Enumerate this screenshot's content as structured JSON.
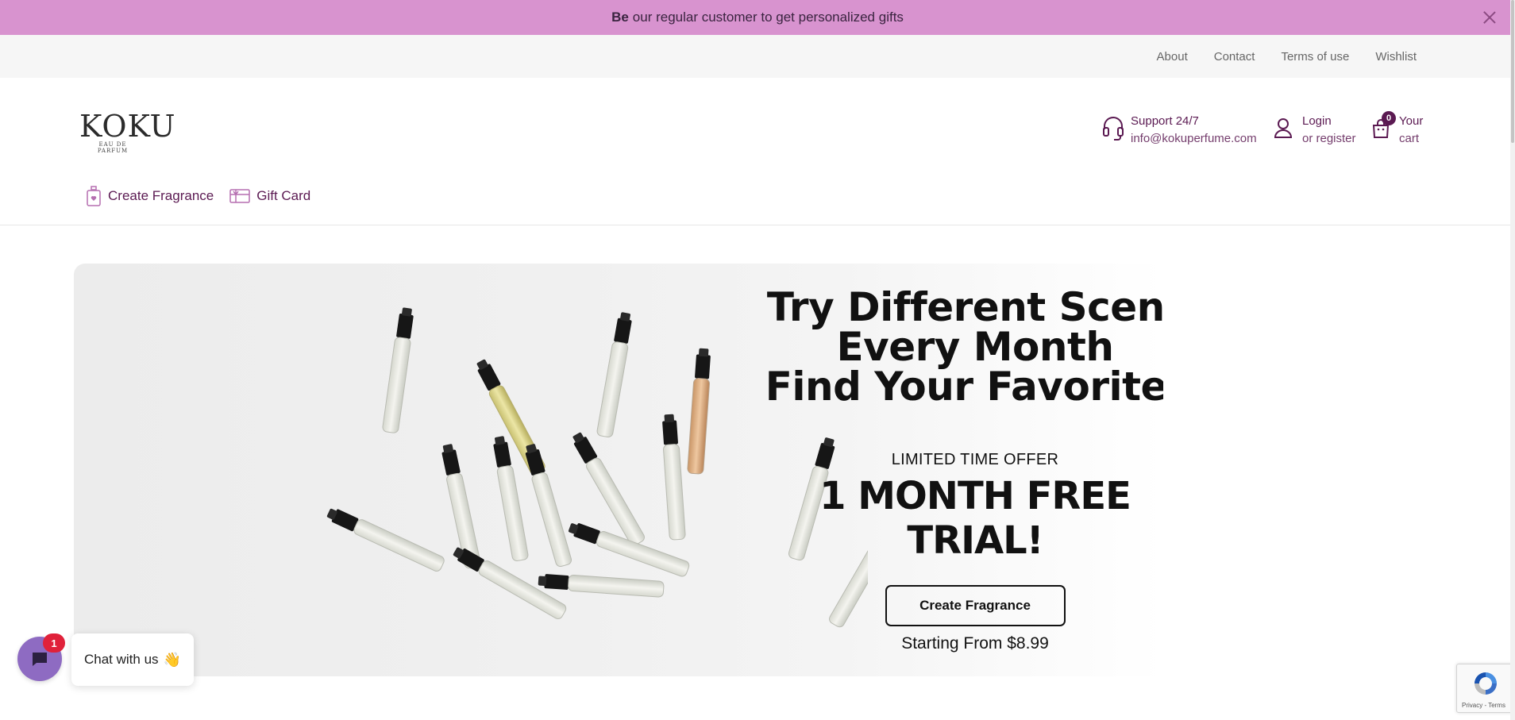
{
  "promo": {
    "bold": "Be",
    "text": "our regular customer to get personalized gifts",
    "close_icon": "close-icon",
    "background": "#d893cf"
  },
  "top_links": [
    "About",
    "Contact",
    "Terms of use",
    "Wishlist"
  ],
  "header": {
    "logo_text": "KOKU",
    "logo_subtext": "EAU DE PARFUM",
    "support": {
      "title": "Support 24/7",
      "email": "info@kokuperfume.com",
      "icon": "headset-icon"
    },
    "login": {
      "title": "Login",
      "subtitle": "or register",
      "icon": "user-icon"
    },
    "cart": {
      "title": "Your",
      "subtitle": "cart",
      "count": "0",
      "icon": "cart-icon"
    },
    "accent_color": "#5b1a52"
  },
  "nav": {
    "create_fragrance": "Create Fragrance",
    "gift_card": "Gift Card"
  },
  "hero": {
    "title_line1": "Try Different Scent",
    "title_line2": "Every Month",
    "title_line3": "Find Your Favorite!",
    "offer": "LIMITED TIME OFFER",
    "trial": "1 MONTH FREE TRIAL!",
    "cta": "Create Fragrance",
    "price": "Starting From $8.99"
  },
  "chat": {
    "badge": "1",
    "label": "Chat with us",
    "wave": "👋",
    "color": "#8e6bc2"
  },
  "recaptcha": {
    "legal": "Privacy - Terms"
  }
}
